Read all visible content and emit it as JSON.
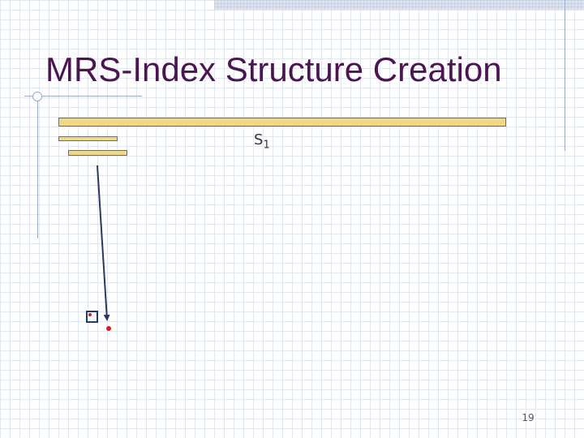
{
  "slide": {
    "title": "MRS-Index Structure Creation",
    "sequence_label": "S",
    "sequence_subscript": "1",
    "page_number": "19"
  }
}
